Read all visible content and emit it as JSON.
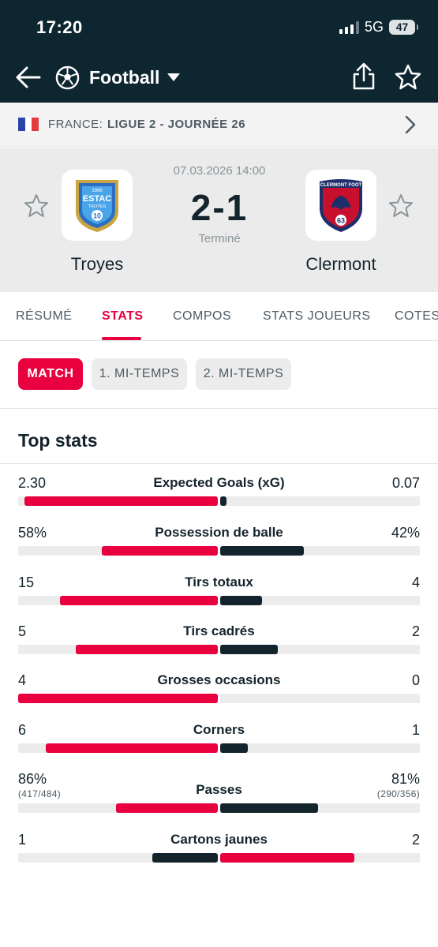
{
  "status_bar": {
    "time": "17:20",
    "network": "5G",
    "battery": "47"
  },
  "app_bar": {
    "sport": "Football",
    "sport_icon": "soccer-ball-icon"
  },
  "league": {
    "country": "FRANCE:",
    "competition": "LIGUE 2 - JOURNÉE 26"
  },
  "match": {
    "date": "07.03.2026 14:00",
    "score": "2-1",
    "status": "Terminé",
    "home": {
      "name": "Troyes",
      "logo_text": [
        "1986",
        "ESTAC",
        "TROYES",
        "10"
      ]
    },
    "away": {
      "name": "Clermont",
      "logo_text": [
        "CLERMONT FOOT",
        "63"
      ]
    }
  },
  "tabs": [
    "RÉSUMÉ",
    "STATS",
    "COMPOS",
    "STATS JOUEURS",
    "COTES"
  ],
  "active_tab": "STATS",
  "periods": [
    "MATCH",
    "1. MI-TEMPS",
    "2. MI-TEMPS"
  ],
  "active_period": "MATCH",
  "section_title": "Top stats",
  "colors": {
    "accent": "#e8003f",
    "dark": "#14242c",
    "track": "#ececec",
    "header": "#0e2630"
  },
  "stats": [
    {
      "label": "Expected Goals (xG)",
      "home": "2.30",
      "away": "0.07",
      "home_share": 0.97,
      "away_share": 0.03,
      "home_color": "#e8003f",
      "away_color": "#14242c"
    },
    {
      "label": "Possession de balle",
      "home": "58%",
      "away": "42%",
      "home_share": 0.58,
      "away_share": 0.42,
      "home_color": "#e8003f",
      "away_color": "#14242c"
    },
    {
      "label": "Tirs totaux",
      "home": "15",
      "away": "4",
      "home_share": 0.79,
      "away_share": 0.21,
      "home_color": "#e8003f",
      "away_color": "#14242c"
    },
    {
      "label": "Tirs cadrés",
      "home": "5",
      "away": "2",
      "home_share": 0.71,
      "away_share": 0.29,
      "home_color": "#e8003f",
      "away_color": "#14242c"
    },
    {
      "label": "Grosses occasions",
      "home": "4",
      "away": "0",
      "home_share": 1.0,
      "away_share": 0.0,
      "home_color": "#e8003f",
      "away_color": "#14242c"
    },
    {
      "label": "Corners",
      "home": "6",
      "away": "1",
      "home_share": 0.86,
      "away_share": 0.14,
      "home_color": "#e8003f",
      "away_color": "#14242c"
    },
    {
      "label": "Passes",
      "home": "86%",
      "away": "81%",
      "home_sub": "(417/484)",
      "away_sub": "(290/356)",
      "home_share": 0.51,
      "away_share": 0.49,
      "home_color": "#e8003f",
      "away_color": "#14242c"
    },
    {
      "label": "Cartons jaunes",
      "home": "1",
      "away": "2",
      "home_share": 0.33,
      "away_share": 0.67,
      "home_color": "#14242c",
      "away_color": "#e8003f"
    }
  ]
}
